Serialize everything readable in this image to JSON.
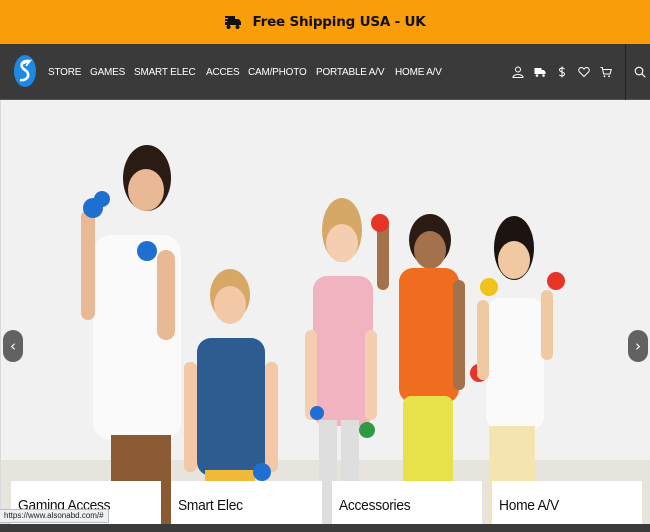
{
  "banner": {
    "text": "Free Shipping USA - UK",
    "icon": "delivery-truck-icon"
  },
  "nav": {
    "logo_icon": "store-logo-icon",
    "items": [
      "STORE",
      "GAMES",
      "SMART ELEC",
      "ACCES",
      "CAM/PHOTO",
      "PORTABLE A/V",
      "HOME A/V"
    ],
    "icons": [
      "user-icon",
      "truck-icon",
      "dollar-icon",
      "heart-icon",
      "cart-icon",
      "search-icon"
    ]
  },
  "hero": {
    "prev_label": "‹",
    "next_label": "›",
    "categories": [
      "Gaming Access",
      "Smart Elec",
      "Accessories",
      "Home A/V"
    ]
  },
  "status": {
    "url": "https://www.alsonabd.com/#"
  },
  "colors": {
    "banner": "#f99d0a",
    "nav": "#3a3a3a",
    "logo": "#1e88e5"
  }
}
